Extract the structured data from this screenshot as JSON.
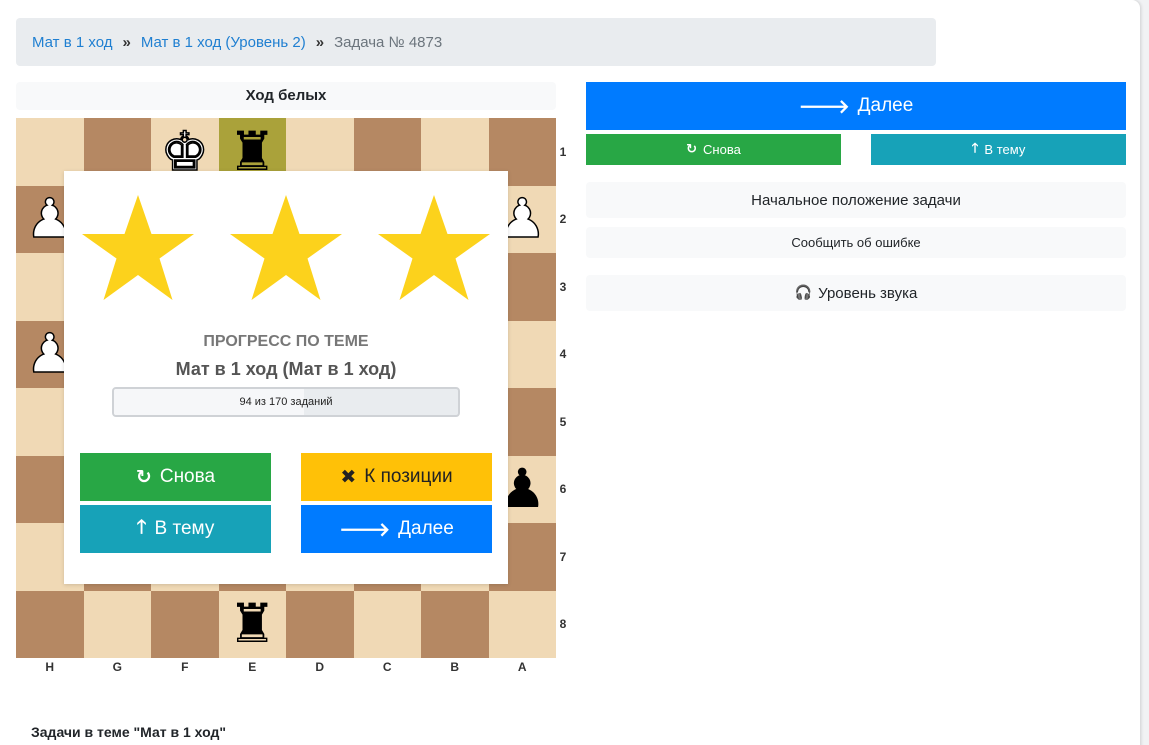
{
  "breadcrumb": {
    "item1": "Мат в 1 ход",
    "item2": "Мат в 1 ход (Уровень 2)",
    "separator": "»",
    "current": "Задача № 4873"
  },
  "board": {
    "turn_label": "Ход белых",
    "rank_labels": [
      "1",
      "2",
      "3",
      "4",
      "5",
      "6",
      "7",
      "8"
    ],
    "file_labels": [
      "H",
      "G",
      "F",
      "E",
      "D",
      "C",
      "B",
      "A"
    ],
    "pieces": {
      "king_white": "♚",
      "rook_black": "♜",
      "pawn_white": "♟",
      "pawn_black": "♟"
    },
    "highlight_color": "#aaa23a"
  },
  "modal": {
    "stars_earned": 3,
    "stars_total": 3,
    "star_color": "#fcd21c",
    "progress_title": "ПРОГРЕСС ПО ТЕМЕ",
    "progress_subtitle": "Мат в 1 ход (Мат в 1 ход)",
    "progress_text": "94 из 170 заданий",
    "progress_done": 94,
    "progress_total": 170,
    "buttons": {
      "retry": "Снова",
      "to_position": "К позиции",
      "to_topic": "В тему",
      "next": "Далее"
    }
  },
  "icons": {
    "retry": "↻",
    "close": "✖",
    "up": "🡑",
    "right": "🡒",
    "headphones": "🎧"
  },
  "right_panel": {
    "next": "Далее",
    "retry": "Снова",
    "to_topic": "В тему",
    "initial_position": "Начальное положение задачи",
    "report_error": "Сообщить об ошибке",
    "sound_level": "Уровень звука"
  },
  "tasks_title": "Задачи в теме \"Мат в 1 ход\"",
  "colors": {
    "green": "#28a745",
    "teal": "#17a2b8",
    "yellow": "#ffc107",
    "blue": "#007bff",
    "link": "#1f7fd1"
  }
}
